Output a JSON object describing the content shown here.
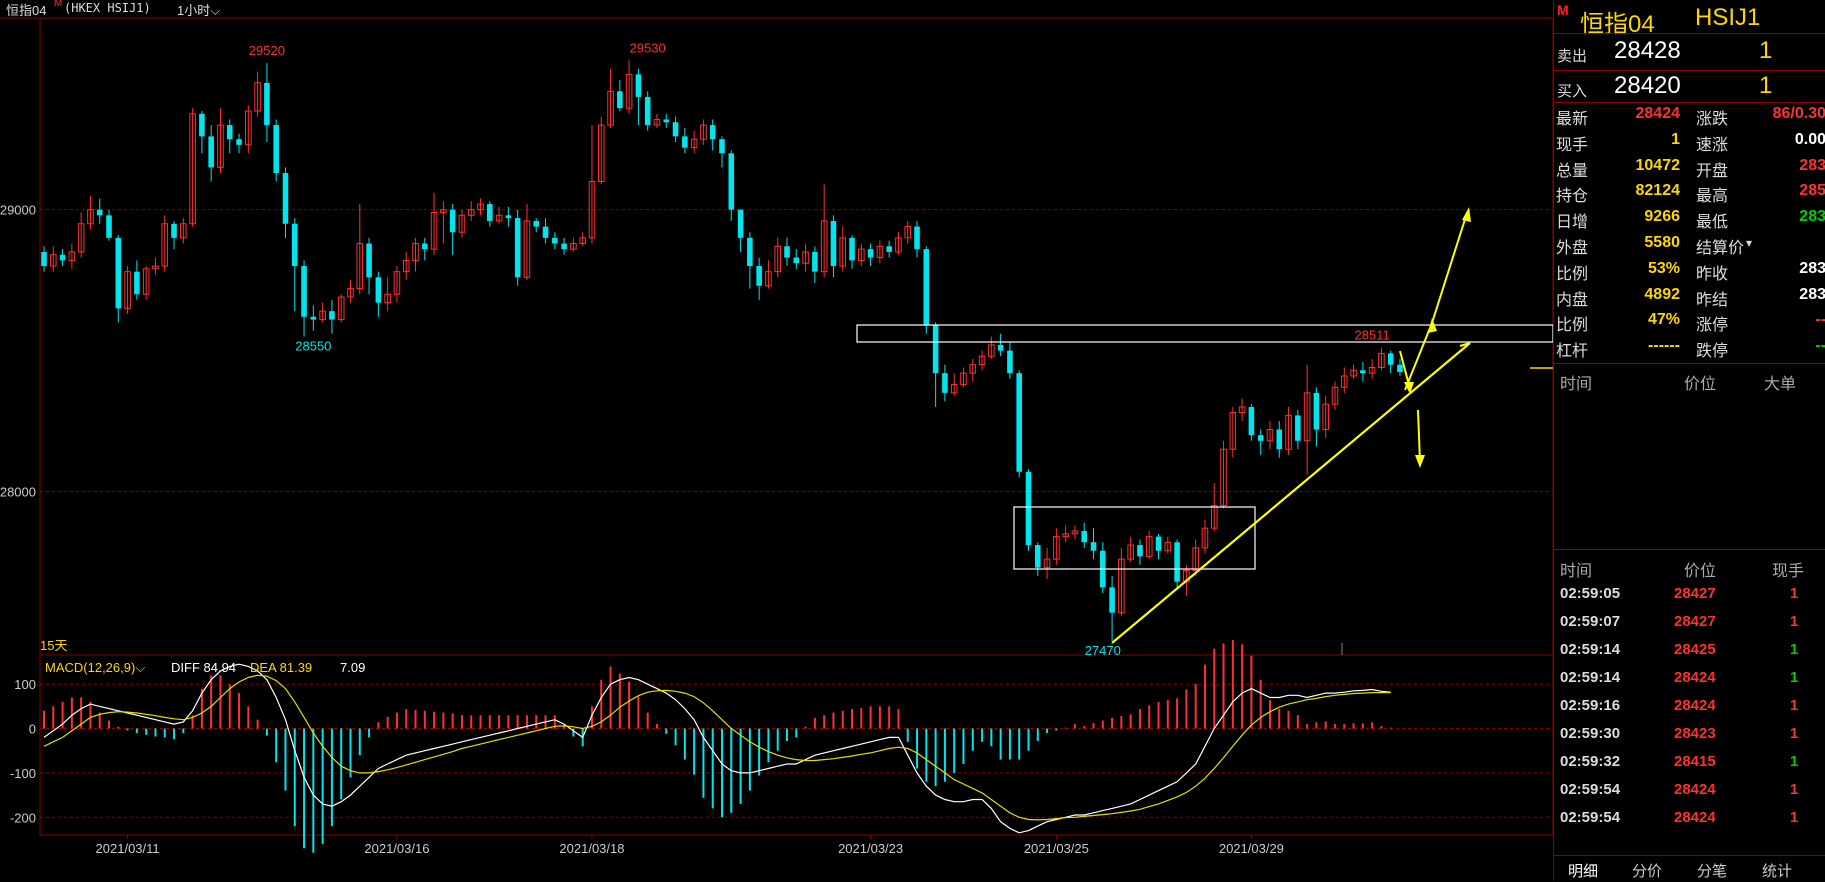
{
  "header": {
    "title": "恒指04",
    "mark": "M",
    "exchange": "(HKEX HSIJ1)",
    "period": "1小时",
    "period_arrow": "⌵"
  },
  "chart_data": {
    "type": "candlestick",
    "ylim": [
      27420,
      29680
    ],
    "yticks": [
      28000,
      29000
    ],
    "y_tick_labels": [
      "28000",
      "29000"
    ],
    "x_tick_labels": [
      "2021/03/11",
      "2021/03/16",
      "2021/03/18",
      "2021/03/23",
      "2021/03/25",
      "2021/03/29"
    ],
    "x_tick_index": [
      9,
      38,
      59,
      89,
      109,
      130
    ],
    "range_label": "15天",
    "annotations": [
      {
        "text": "29520",
        "color": "#ff3030",
        "index": 24,
        "value": 29520,
        "pos": "above"
      },
      {
        "text": "29530",
        "color": "#ff3030",
        "index": 65,
        "value": 29530,
        "pos": "above"
      },
      {
        "text": "28550",
        "color": "#00e5ee",
        "index": 29,
        "value": 28550,
        "pos": "below"
      },
      {
        "text": "27470",
        "color": "#00e5ee",
        "index": 114,
        "value": 27470,
        "pos": "below"
      },
      {
        "text": "28511",
        "color": "#ff3030",
        "index": 143,
        "value": 28511,
        "pos": "above"
      }
    ],
    "candles": [
      [
        28850,
        28800,
        28870,
        28780
      ],
      [
        28800,
        28840,
        28870,
        28780
      ],
      [
        28840,
        28820,
        28860,
        28800
      ],
      [
        28820,
        28850,
        28880,
        28790
      ],
      [
        28850,
        28950,
        28990,
        28830
      ],
      [
        28950,
        29000,
        29050,
        28930
      ],
      [
        29000,
        28980,
        29040,
        28950
      ],
      [
        28980,
        28900,
        29000,
        28890
      ],
      [
        28900,
        28650,
        28910,
        28600
      ],
      [
        28650,
        28780,
        28800,
        28630
      ],
      [
        28780,
        28700,
        28820,
        28680
      ],
      [
        28700,
        28790,
        28800,
        28680
      ],
      [
        28790,
        28800,
        28830,
        28770
      ],
      [
        28800,
        28950,
        28980,
        28780
      ],
      [
        28950,
        28900,
        28960,
        28860
      ],
      [
        28900,
        28950,
        28970,
        28880
      ],
      [
        28950,
        29340,
        29360,
        28940
      ],
      [
        29340,
        29260,
        29350,
        29200
      ],
      [
        29260,
        29150,
        29300,
        29100
      ],
      [
        29150,
        29300,
        29360,
        29130
      ],
      [
        29300,
        29250,
        29320,
        29200
      ],
      [
        29250,
        29230,
        29270,
        29200
      ],
      [
        29230,
        29350,
        29370,
        29200
      ],
      [
        29350,
        29450,
        29490,
        29330
      ],
      [
        29450,
        29300,
        29520,
        29240
      ],
      [
        29300,
        29130,
        29320,
        29100
      ],
      [
        29130,
        28950,
        29150,
        28900
      ],
      [
        28950,
        28800,
        28970,
        28640
      ],
      [
        28800,
        28620,
        28820,
        28550
      ],
      [
        28620,
        28610,
        28660,
        28570
      ],
      [
        28610,
        28640,
        28670,
        28600
      ],
      [
        28640,
        28610,
        28680,
        28560
      ],
      [
        28610,
        28690,
        28700,
        28600
      ],
      [
        28690,
        28720,
        28750,
        28670
      ],
      [
        28720,
        28880,
        29020,
        28700
      ],
      [
        28880,
        28760,
        28900,
        28700
      ],
      [
        28760,
        28670,
        28780,
        28620
      ],
      [
        28670,
        28700,
        28760,
        28640
      ],
      [
        28700,
        28780,
        28800,
        28670
      ],
      [
        28780,
        28820,
        28850,
        28750
      ],
      [
        28820,
        28880,
        28900,
        28780
      ],
      [
        28880,
        28860,
        28900,
        28820
      ],
      [
        28860,
        28990,
        29060,
        28840
      ],
      [
        28990,
        29000,
        29030,
        28880
      ],
      [
        29000,
        28920,
        29020,
        28840
      ],
      [
        28920,
        28980,
        29000,
        28900
      ],
      [
        28980,
        29000,
        29030,
        28960
      ],
      [
        29000,
        29020,
        29040,
        28980
      ],
      [
        29020,
        28960,
        29030,
        28940
      ],
      [
        28960,
        28980,
        29010,
        28950
      ],
      [
        28980,
        28970,
        29010,
        28940
      ],
      [
        28970,
        28760,
        29000,
        28730
      ],
      [
        28760,
        28960,
        29020,
        28750
      ],
      [
        28960,
        28940,
        28970,
        28920
      ],
      [
        28940,
        28900,
        28970,
        28880
      ],
      [
        28900,
        28880,
        28920,
        28860
      ],
      [
        28880,
        28860,
        28900,
        28840
      ],
      [
        28860,
        28880,
        28900,
        28850
      ],
      [
        28880,
        28900,
        28920,
        28870
      ],
      [
        28900,
        29100,
        29300,
        28880
      ],
      [
        29100,
        29300,
        29330,
        29090
      ],
      [
        29300,
        29420,
        29500,
        29290
      ],
      [
        29420,
        29360,
        29460,
        29350
      ],
      [
        29360,
        29480,
        29530,
        29340
      ],
      [
        29480,
        29400,
        29500,
        29300
      ],
      [
        29400,
        29300,
        29420,
        29280
      ],
      [
        29300,
        29320,
        29340,
        29290
      ],
      [
        29320,
        29310,
        29340,
        29290
      ],
      [
        29310,
        29260,
        29330,
        29240
      ],
      [
        29260,
        29220,
        29290,
        29200
      ],
      [
        29220,
        29250,
        29280,
        29200
      ],
      [
        29250,
        29300,
        29320,
        29230
      ],
      [
        29300,
        29250,
        29320,
        29210
      ],
      [
        29250,
        29200,
        29260,
        29150
      ],
      [
        29200,
        29000,
        29210,
        28960
      ],
      [
        29000,
        28900,
        29000,
        28850
      ],
      [
        28900,
        28800,
        28920,
        28720
      ],
      [
        28800,
        28730,
        28830,
        28680
      ],
      [
        28730,
        28780,
        28820,
        28720
      ],
      [
        28780,
        28870,
        28900,
        28760
      ],
      [
        28870,
        28830,
        28900,
        28800
      ],
      [
        28830,
        28810,
        28860,
        28790
      ],
      [
        28810,
        28850,
        28880,
        28780
      ],
      [
        28850,
        28780,
        28870,
        28740
      ],
      [
        28780,
        28960,
        29090,
        28760
      ],
      [
        28960,
        28800,
        28980,
        28760
      ],
      [
        28800,
        28900,
        28940,
        28780
      ],
      [
        28900,
        28820,
        28910,
        28790
      ],
      [
        28820,
        28860,
        28880,
        28800
      ],
      [
        28860,
        28830,
        28880,
        28800
      ],
      [
        28830,
        28870,
        28890,
        28810
      ],
      [
        28870,
        28850,
        28890,
        28830
      ],
      [
        28850,
        28900,
        28920,
        28840
      ],
      [
        28900,
        28940,
        28960,
        28880
      ],
      [
        28940,
        28860,
        28960,
        28830
      ],
      [
        28860,
        28590,
        28870,
        28560
      ],
      [
        28590,
        28420,
        28600,
        28300
      ],
      [
        28420,
        28350,
        28450,
        28320
      ],
      [
        28350,
        28380,
        28420,
        28340
      ],
      [
        28380,
        28420,
        28440,
        28370
      ],
      [
        28420,
        28450,
        28470,
        28390
      ],
      [
        28450,
        28480,
        28500,
        28430
      ],
      [
        28480,
        28520,
        28550,
        28470
      ],
      [
        28520,
        28500,
        28560,
        28480
      ],
      [
        28500,
        28420,
        28530,
        28400
      ],
      [
        28420,
        28070,
        28430,
        28050
      ],
      [
        28070,
        27810,
        28080,
        27790
      ],
      [
        27810,
        27730,
        27820,
        27700
      ],
      [
        27730,
        27760,
        27800,
        27690
      ],
      [
        27760,
        27840,
        27870,
        27740
      ],
      [
        27840,
        27850,
        27880,
        27820
      ],
      [
        27850,
        27860,
        27880,
        27830
      ],
      [
        27860,
        27820,
        27890,
        27800
      ],
      [
        27820,
        27790,
        27870,
        27760
      ],
      [
        27790,
        27660,
        27820,
        27640
      ],
      [
        27660,
        27570,
        27700,
        27470
      ],
      [
        27570,
        27760,
        27800,
        27560
      ],
      [
        27760,
        27810,
        27840,
        27750
      ],
      [
        27810,
        27770,
        27830,
        27740
      ],
      [
        27770,
        27840,
        27860,
        27760
      ],
      [
        27840,
        27790,
        27850,
        27760
      ],
      [
        27790,
        27820,
        27840,
        27780
      ],
      [
        27820,
        27680,
        27830,
        27660
      ],
      [
        27680,
        27720,
        27740,
        27630
      ],
      [
        27720,
        27800,
        27830,
        27700
      ],
      [
        27800,
        27870,
        27900,
        27780
      ],
      [
        27870,
        27950,
        28030,
        27860
      ],
      [
        27950,
        28150,
        28180,
        27940
      ],
      [
        28150,
        28280,
        28300,
        28120
      ],
      [
        28280,
        28300,
        28330,
        28250
      ],
      [
        28300,
        28200,
        28310,
        28180
      ],
      [
        28200,
        28180,
        28220,
        28130
      ],
      [
        28180,
        28220,
        28250,
        28150
      ],
      [
        28220,
        28150,
        28250,
        28120
      ],
      [
        28150,
        28270,
        28300,
        28130
      ],
      [
        28270,
        28180,
        28290,
        28150
      ],
      [
        28180,
        28350,
        28450,
        28060
      ],
      [
        28350,
        28220,
        28370,
        28160
      ],
      [
        28220,
        28310,
        28340,
        28190
      ],
      [
        28310,
        28370,
        28390,
        28290
      ],
      [
        28370,
        28410,
        28440,
        28350
      ],
      [
        28410,
        28430,
        28450,
        28400
      ],
      [
        28430,
        28420,
        28460,
        28390
      ],
      [
        28420,
        28440,
        28470,
        28400
      ],
      [
        28440,
        28490,
        28511,
        28430
      ],
      [
        28490,
        28450,
        28500,
        28420
      ],
      [
        28450,
        28424,
        28470,
        28410
      ]
    ],
    "macd": {
      "label": "MACD(12,26,9)",
      "label_arrow": "⌵",
      "diff_label": "DIFF 84.94",
      "dea_label": "DEA 81.39",
      "hist_label": "7.09",
      "ylim": [
        -240,
        150
      ],
      "yticks": [
        100,
        0,
        -100,
        -200
      ],
      "ytick_labels": [
        "100",
        "0",
        "-100",
        "-200"
      ],
      "diff": [
        -20,
        -5,
        10,
        30,
        45,
        55,
        50,
        45,
        40,
        35,
        30,
        25,
        20,
        15,
        10,
        15,
        40,
        80,
        110,
        130,
        140,
        145,
        140,
        130,
        110,
        70,
        20,
        -50,
        -110,
        -150,
        -170,
        -175,
        -165,
        -150,
        -130,
        -110,
        -90,
        -80,
        -70,
        -60,
        -55,
        -50,
        -45,
        -40,
        -35,
        -30,
        -25,
        -20,
        -15,
        -10,
        -5,
        0,
        5,
        10,
        15,
        20,
        10,
        -5,
        -20,
        30,
        70,
        100,
        110,
        115,
        110,
        100,
        90,
        80,
        65,
        45,
        20,
        -20,
        -50,
        -80,
        -95,
        -100,
        -100,
        -95,
        -90,
        -85,
        -80,
        -80,
        -70,
        -60,
        -55,
        -50,
        -45,
        -40,
        -35,
        -30,
        -25,
        -20,
        -20,
        -60,
        -100,
        -130,
        -150,
        -160,
        -165,
        -165,
        -160,
        -160,
        -180,
        -210,
        -225,
        -235,
        -230,
        -220,
        -210,
        -205,
        -200,
        -195,
        -195,
        -190,
        -185,
        -180,
        -175,
        -170,
        -160,
        -150,
        -140,
        -130,
        -120,
        -100,
        -80,
        -40,
        0,
        30,
        60,
        80,
        90,
        80,
        70,
        70,
        75,
        75,
        70,
        75,
        80,
        80,
        82,
        85,
        86,
        88,
        84,
        82,
        84
      ],
      "dea": [
        -40,
        -30,
        -20,
        -5,
        10,
        25,
        32,
        36,
        38,
        37,
        35,
        32,
        29,
        25,
        22,
        20,
        25,
        35,
        50,
        70,
        90,
        105,
        115,
        120,
        118,
        108,
        90,
        60,
        25,
        -10,
        -40,
        -65,
        -85,
        -95,
        -100,
        -100,
        -97,
        -93,
        -88,
        -82,
        -76,
        -70,
        -64,
        -58,
        -52,
        -45,
        -40,
        -35,
        -30,
        -25,
        -20,
        -15,
        -10,
        -5,
        0,
        5,
        6,
        4,
        0,
        5,
        15,
        30,
        48,
        62,
        74,
        82,
        85,
        86,
        84,
        80,
        72,
        58,
        40,
        20,
        0,
        -15,
        -30,
        -42,
        -52,
        -60,
        -66,
        -70,
        -72,
        -72,
        -70,
        -68,
        -65,
        -62,
        -58,
        -55,
        -50,
        -45,
        -42,
        -45,
        -55,
        -70,
        -85,
        -100,
        -115,
        -125,
        -135,
        -145,
        -160,
        -175,
        -190,
        -200,
        -205,
        -206,
        -205,
        -203,
        -201,
        -200,
        -198,
        -196,
        -194,
        -192,
        -189,
        -186,
        -182,
        -176,
        -170,
        -162,
        -154,
        -144,
        -130,
        -112,
        -90,
        -66,
        -40,
        -15,
        8,
        25,
        38,
        48,
        55,
        60,
        65,
        68,
        72,
        75,
        77,
        79,
        80,
        81,
        81,
        81
      ]
    }
  },
  "panel": {
    "mark": "M",
    "name": "恒指04",
    "code": "HSIJ1",
    "sell_label": "卖出",
    "sell_price": "28428",
    "sell_vol": "1",
    "buy_label": "买入",
    "buy_price": "28420",
    "buy_vol": "1",
    "stats_left": [
      {
        "k": "最新",
        "v": "28424",
        "c": "#ff3030"
      },
      {
        "k": "现手",
        "v": "1",
        "c": "#ffd700"
      },
      {
        "k": "总量",
        "v": "10472",
        "c": "#ffd700"
      },
      {
        "k": "持仓",
        "v": "82124",
        "c": "#ffd700"
      },
      {
        "k": "日增",
        "v": "9266",
        "c": "#ffd700"
      },
      {
        "k": "外盘",
        "v": "5580",
        "c": "#ffd700"
      },
      {
        "k": "比例",
        "v": "53%",
        "c": "#ffd700"
      },
      {
        "k": "内盘",
        "v": "4892",
        "c": "#ffd700"
      },
      {
        "k": "比例",
        "v": "47%",
        "c": "#ffd700"
      },
      {
        "k": "杠杆",
        "v": "------",
        "c": "#ffd700"
      }
    ],
    "stats_right": [
      {
        "k": "涨跌",
        "v": "86/0.30",
        "c": "#ff3030"
      },
      {
        "k": "速涨",
        "v": "0.00",
        "c": "#ffffff"
      },
      {
        "k": "开盘",
        "v": "283",
        "c": "#ff3030"
      },
      {
        "k": "最高",
        "v": "285",
        "c": "#ff3030"
      },
      {
        "k": "最低",
        "v": "283",
        "c": "#00d000"
      },
      {
        "k": "结算价",
        "v": "",
        "c": "#ffffff"
      },
      {
        "k": "昨收",
        "v": "283",
        "c": "#ffffff"
      },
      {
        "k": "昨结",
        "v": "283",
        "c": "#ffffff"
      },
      {
        "k": "涨停",
        "v": "--",
        "c": "#ff3030"
      },
      {
        "k": "跌停",
        "v": "--",
        "c": "#00d000"
      }
    ],
    "big_hdr": [
      "时间",
      "价位",
      "大单"
    ],
    "tick_hdr": [
      "时间",
      "价位",
      "现手"
    ],
    "ticks": [
      {
        "t": "02:59:05",
        "p": "28427",
        "v": "1",
        "vc": "#ff3030"
      },
      {
        "t": "02:59:07",
        "p": "28427",
        "v": "1",
        "vc": "#ff3030"
      },
      {
        "t": "02:59:14",
        "p": "28425",
        "v": "1",
        "vc": "#00d000"
      },
      {
        "t": "02:59:14",
        "p": "28424",
        "v": "1",
        "vc": "#00d000"
      },
      {
        "t": "02:59:16",
        "p": "28424",
        "v": "1",
        "vc": "#ff3030"
      },
      {
        "t": "02:59:30",
        "p": "28423",
        "v": "1",
        "vc": "#ff3030"
      },
      {
        "t": "02:59:32",
        "p": "28415",
        "v": "1",
        "vc": "#00d000"
      },
      {
        "t": "02:59:54",
        "p": "28424",
        "v": "1",
        "vc": "#ff3030"
      },
      {
        "t": "02:59:54",
        "p": "28424",
        "v": "1",
        "vc": "#ff3030"
      }
    ],
    "tabs": [
      "明细",
      "分价",
      "分笔",
      "统计"
    ]
  },
  "colors": {
    "up": "#ff3030",
    "down": "#00e5ee",
    "grid": "#8b0000",
    "axis_text": "#cccccc",
    "arrow": "#ffff00",
    "diff": "#ffffff",
    "dea": "#e0e000"
  }
}
